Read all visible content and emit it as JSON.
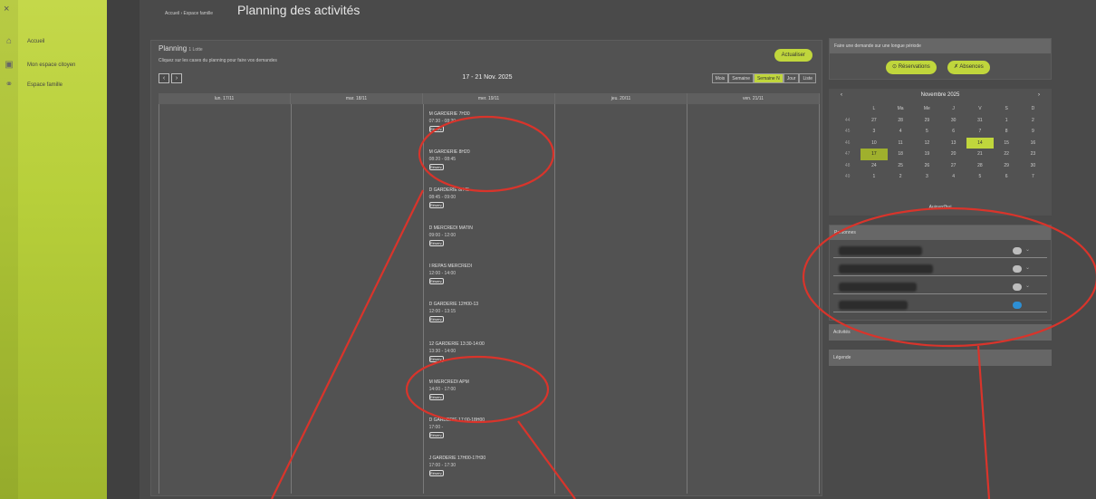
{
  "sidebar": {
    "close": "×",
    "items": [
      {
        "label": "Accueil",
        "icon": "home-icon"
      },
      {
        "label": "Mon espace citoyen",
        "icon": "id-card-icon"
      },
      {
        "label": "Espace famille",
        "icon": "family-icon"
      }
    ]
  },
  "header": {
    "breadcrumb": "Accueil › Espace famille",
    "title": "Planning des activités"
  },
  "planning": {
    "title": "Planning",
    "title_suffix": "1 Lotte",
    "subtitle": "Cliquez sur les cases du planning pour faire vos demandes",
    "refresh": "Actualiser",
    "prev": "‹",
    "next": "›",
    "range": "17 - 21 Nov. 2025",
    "views": [
      "Mois",
      "Semaine",
      "Semaine N",
      "Jour",
      "Liste"
    ],
    "active_view": "Semaine N",
    "days": [
      "lun. 17/11",
      "mar. 18/11",
      "mer. 19/11",
      "jeu. 20/11",
      "ven. 21/11"
    ],
    "events": [
      {
        "title": "M GARDERIE 7H30",
        "time": "07:30 - 08:20",
        "tag": "Réserv."
      },
      {
        "title": "M GARDERIE 8H20",
        "time": "08:20 - 08:45",
        "tag": "Réserv."
      },
      {
        "title": "D GARDERIE 8H45",
        "time": "08:45 - 09:00",
        "tag": "Réserv."
      },
      {
        "title": "D MERCREDI MATIN",
        "time": "09:00 - 12:00",
        "tag": "Réserv."
      },
      {
        "title": "I REPAS MERCREDI",
        "time": "12:00 - 14:00",
        "tag": "Réserv."
      },
      {
        "title": "D GARDERIE 12H00-13",
        "time": "12:00 - 13:15",
        "tag": "Réserv."
      },
      {
        "title": "12 GARDERIE 13:30-14:00",
        "time": "13:30 - 14:00",
        "tag": "Réserv."
      },
      {
        "title": "M MERCREDI APM",
        "time": "14:00 - 17:00",
        "tag": "Réserv."
      },
      {
        "title": "D GARDERIE 17:00-18H00",
        "time": "17:00 - ",
        "tag": "Réserv."
      },
      {
        "title": "J GARDERIE 17H00-17H30",
        "time": "17:00 - 17:30",
        "tag": "Réserv."
      }
    ]
  },
  "right": {
    "demand_header": "Faire une demande sur une longue période",
    "btn_reservations": "Réservations",
    "btn_absences": "Absences",
    "calendar": {
      "prev": "‹",
      "next": "›",
      "month": "Novembre 2025",
      "weekdays": [
        "",
        "L",
        "Ma",
        "Me",
        "J",
        "V",
        "S",
        "D"
      ],
      "weeks": [
        [
          "44",
          "27",
          "28",
          "29",
          "30",
          "31",
          "1",
          "2"
        ],
        [
          "45",
          "3",
          "4",
          "5",
          "6",
          "7",
          "8",
          "9"
        ],
        [
          "46",
          "10",
          "11",
          "12",
          "13",
          "14",
          "15",
          "16"
        ],
        [
          "47",
          "17",
          "18",
          "19",
          "20",
          "21",
          "22",
          "23"
        ],
        [
          "48",
          "24",
          "25",
          "26",
          "27",
          "28",
          "29",
          "30"
        ],
        [
          "49",
          "1",
          "2",
          "3",
          "4",
          "5",
          "6",
          "7"
        ]
      ],
      "today_label": "Aujourd'hui"
    },
    "filters_header": "Personnes",
    "filter_rows": 4,
    "section_2": "Activités",
    "section_3": "Légende"
  },
  "colors": {
    "accent": "#c0d63c",
    "annotation": "#d9342b",
    "toggle_on": "#2d8fd4"
  }
}
